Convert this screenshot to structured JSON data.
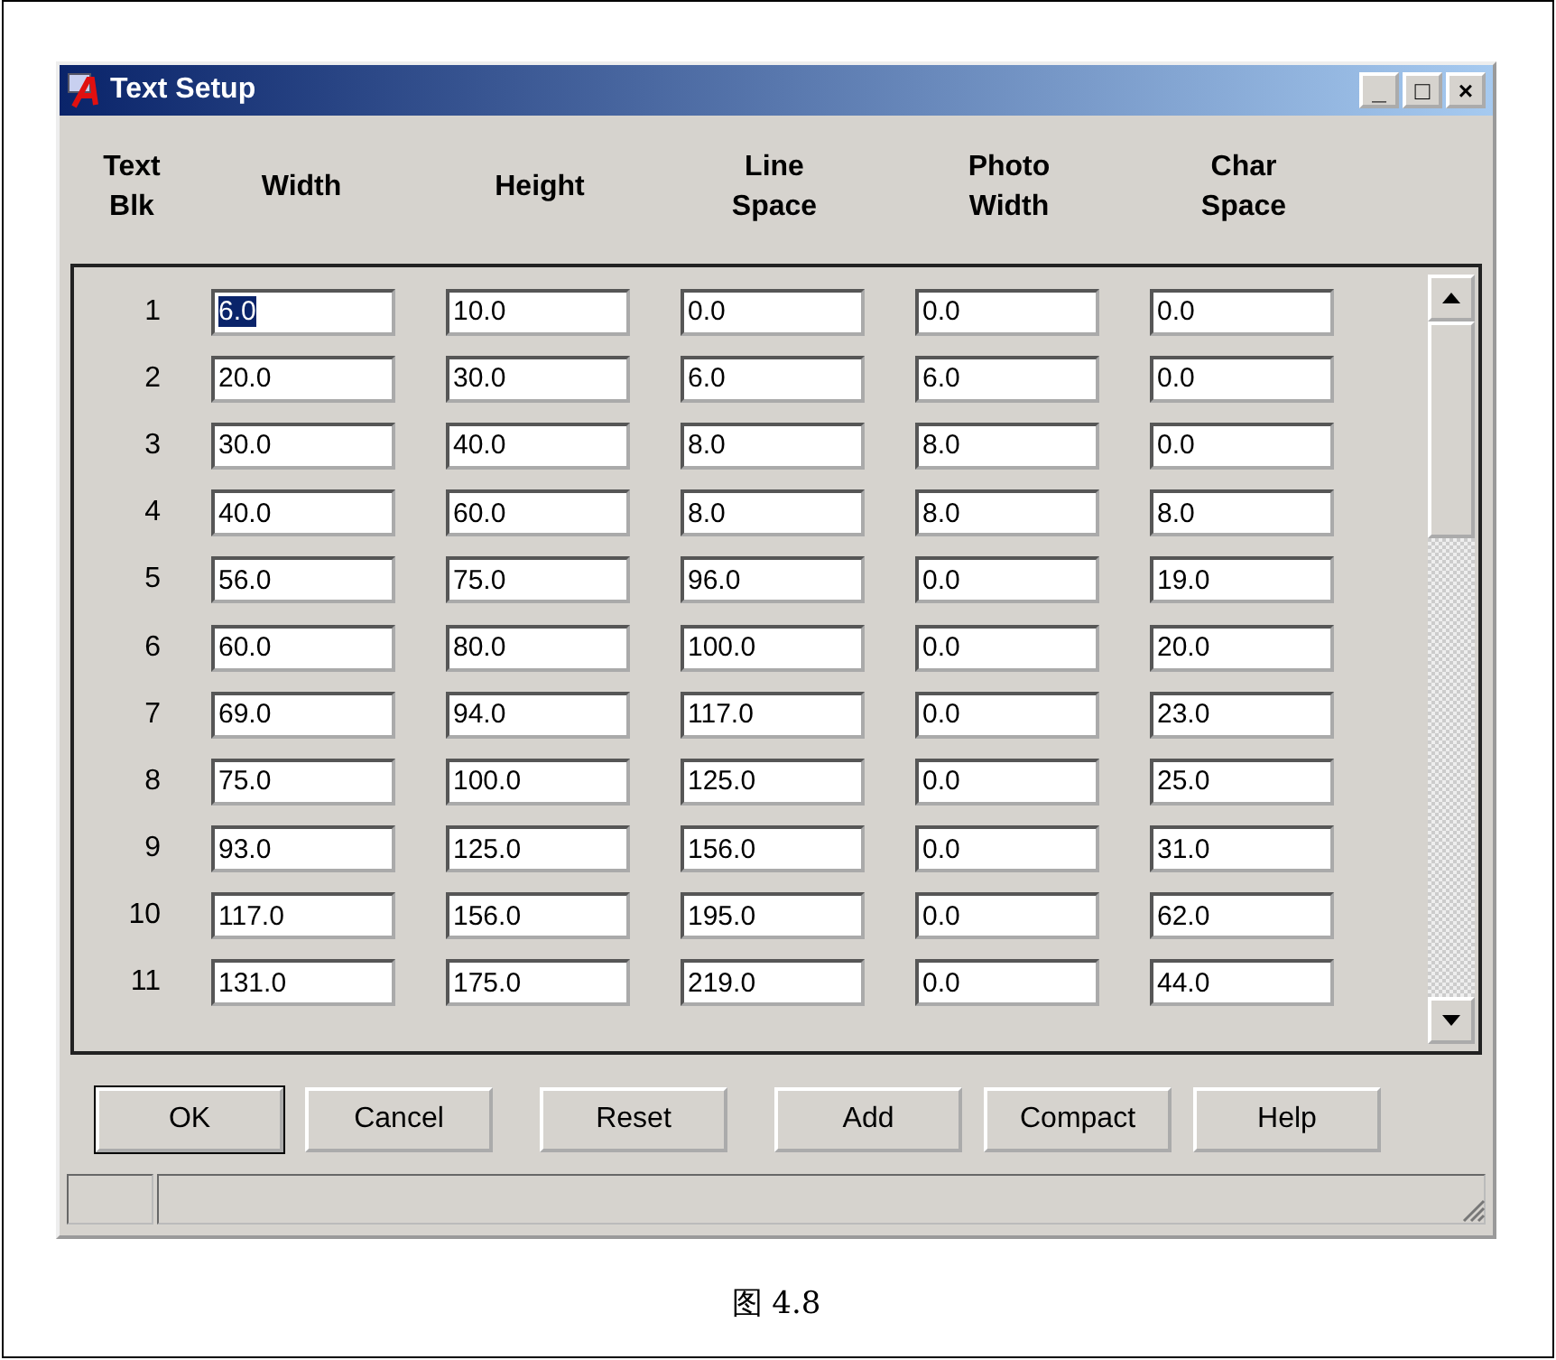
{
  "window": {
    "title": "Text Setup",
    "controls": [
      "_",
      "□",
      "×"
    ]
  },
  "columns": [
    {
      "label": "Text\nBlk"
    },
    {
      "label": "Width"
    },
    {
      "label": "Height"
    },
    {
      "label": "Line\nSpace"
    },
    {
      "label": "Photo\nWidth"
    },
    {
      "label": "Char\nSpace"
    }
  ],
  "rows": [
    {
      "blk": "1",
      "cells": [
        {
          "value": "6.0",
          "selected": true
        },
        {
          "value": "10.0",
          "selected": false
        },
        {
          "value": "0.0",
          "selected": false
        },
        {
          "value": "0.0",
          "selected": false
        },
        {
          "value": "0.0",
          "selected": false
        }
      ]
    },
    {
      "blk": "2",
      "cells": [
        {
          "value": "20.0",
          "selected": false
        },
        {
          "value": "30.0",
          "selected": false
        },
        {
          "value": "6.0",
          "selected": false
        },
        {
          "value": "6.0",
          "selected": false
        },
        {
          "value": "0.0",
          "selected": false
        }
      ]
    },
    {
      "blk": "3",
      "cells": [
        {
          "value": "30.0",
          "selected": false
        },
        {
          "value": "40.0",
          "selected": false
        },
        {
          "value": "8.0",
          "selected": false
        },
        {
          "value": "8.0",
          "selected": false
        },
        {
          "value": "0.0",
          "selected": false
        }
      ]
    },
    {
      "blk": "4",
      "cells": [
        {
          "value": "40.0",
          "selected": false
        },
        {
          "value": "60.0",
          "selected": false
        },
        {
          "value": "8.0",
          "selected": false
        },
        {
          "value": "8.0",
          "selected": false
        },
        {
          "value": "8.0",
          "selected": false
        }
      ]
    },
    {
      "blk": "5",
      "cells": [
        {
          "value": "56.0",
          "selected": false
        },
        {
          "value": "75.0",
          "selected": false
        },
        {
          "value": "96.0",
          "selected": false
        },
        {
          "value": "0.0",
          "selected": false
        },
        {
          "value": "19.0",
          "selected": false
        }
      ]
    },
    {
      "blk": "6",
      "cells": [
        {
          "value": "60.0",
          "selected": false
        },
        {
          "value": "80.0",
          "selected": false
        },
        {
          "value": "100.0",
          "selected": false
        },
        {
          "value": "0.0",
          "selected": false
        },
        {
          "value": "20.0",
          "selected": false
        }
      ]
    },
    {
      "blk": "7",
      "cells": [
        {
          "value": "69.0",
          "selected": false
        },
        {
          "value": "94.0",
          "selected": false
        },
        {
          "value": "117.0",
          "selected": false
        },
        {
          "value": "0.0",
          "selected": false
        },
        {
          "value": "23.0",
          "selected": false
        }
      ]
    },
    {
      "blk": "8",
      "cells": [
        {
          "value": "75.0",
          "selected": false
        },
        {
          "value": "100.0",
          "selected": false
        },
        {
          "value": "125.0",
          "selected": false
        },
        {
          "value": "0.0",
          "selected": false
        },
        {
          "value": "25.0",
          "selected": false
        }
      ]
    },
    {
      "blk": "9",
      "cells": [
        {
          "value": "93.0",
          "selected": false
        },
        {
          "value": "125.0",
          "selected": false
        },
        {
          "value": "156.0",
          "selected": false
        },
        {
          "value": "0.0",
          "selected": false
        },
        {
          "value": "31.0",
          "selected": false
        }
      ]
    },
    {
      "blk": "10",
      "cells": [
        {
          "value": "117.0",
          "selected": false
        },
        {
          "value": "156.0",
          "selected": false
        },
        {
          "value": "195.0",
          "selected": false
        },
        {
          "value": "0.0",
          "selected": false
        },
        {
          "value": "62.0",
          "selected": false
        }
      ]
    },
    {
      "blk": "11",
      "cells": [
        {
          "value": "131.0",
          "selected": false
        },
        {
          "value": "175.0",
          "selected": false
        },
        {
          "value": "219.0",
          "selected": false
        },
        {
          "value": "0.0",
          "selected": false
        },
        {
          "value": "44.0",
          "selected": false
        }
      ]
    }
  ],
  "buttons": [
    {
      "label": "OK",
      "default": true
    },
    {
      "label": "Cancel",
      "default": false
    },
    {
      "label": "Reset",
      "default": false
    },
    {
      "label": "Add",
      "default": false
    },
    {
      "label": "Compact",
      "default": false
    },
    {
      "label": "Help",
      "default": false
    }
  ],
  "caption": "图 4.8"
}
